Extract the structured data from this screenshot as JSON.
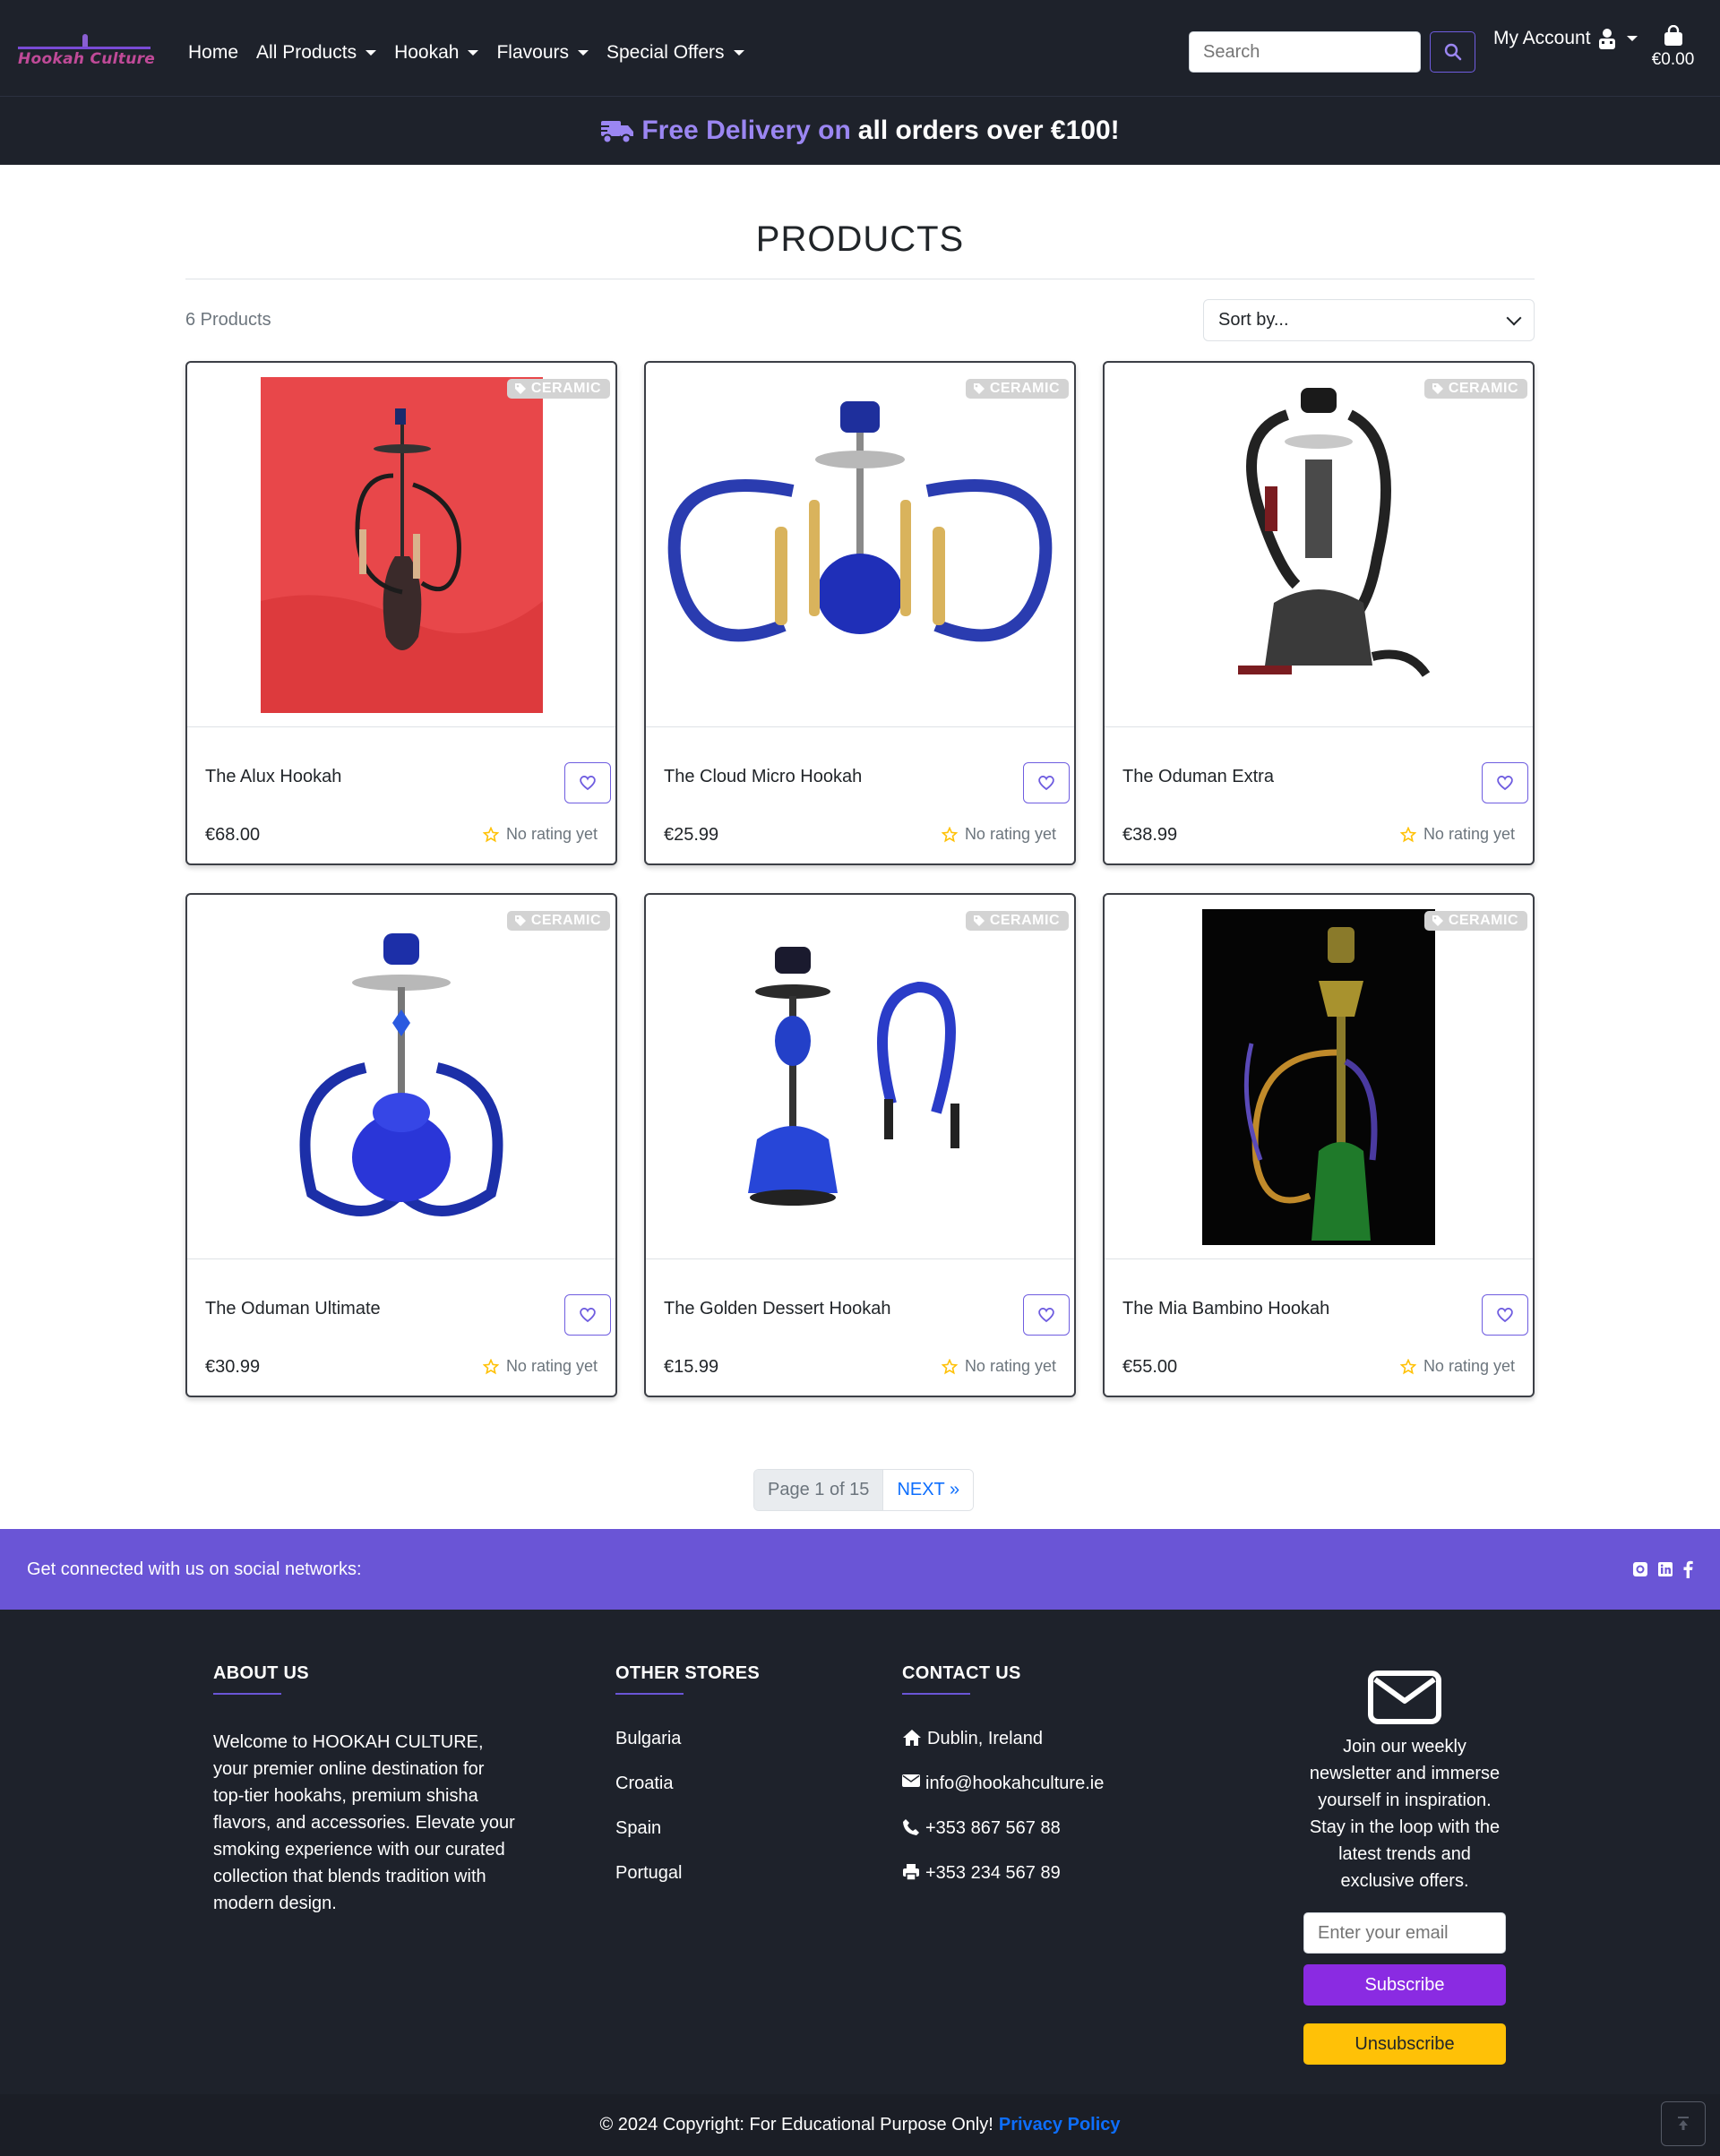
{
  "colors": {
    "accent": "#6a55d6",
    "dark_bg": "#1e222b",
    "promo_purple": "#9b86f2",
    "subscribe": "#8a2be2",
    "unsubscribe": "#ffc107",
    "link_blue": "#0d6efd"
  },
  "nav": {
    "logo_text": "Hookah Culture",
    "links": [
      {
        "label": "Home",
        "dropdown": false
      },
      {
        "label": "All Products",
        "dropdown": true
      },
      {
        "label": "Hookah",
        "dropdown": true
      },
      {
        "label": "Flavours",
        "dropdown": true
      },
      {
        "label": "Special Offers",
        "dropdown": true
      }
    ],
    "search_placeholder": "Search",
    "account_label": "My Account",
    "cart_total": "€0.00"
  },
  "promo": {
    "highlight": "Free Delivery on",
    "rest": "all orders over €100!"
  },
  "main": {
    "title": "PRODUCTS",
    "count": "6 Products",
    "sort_value": "Sort by..."
  },
  "products": [
    {
      "name": "The Alux Hookah",
      "price": "€68.00",
      "badge": "CERAMIC",
      "rating": "No rating yet",
      "image": "red-backdrop-hookah"
    },
    {
      "name": "The Cloud Micro Hookah",
      "price": "€25.99",
      "badge": "CERAMIC",
      "rating": "No rating yet",
      "image": "blue-double-hose-hookah"
    },
    {
      "name": "The Oduman Extra",
      "price": "€38.99",
      "badge": "CERAMIC",
      "rating": "No rating yet",
      "image": "black-checkered-hookah"
    },
    {
      "name": "The Oduman Ultimate",
      "price": "€30.99",
      "badge": "CERAMIC",
      "rating": "No rating yet",
      "image": "blue-frosted-hookah"
    },
    {
      "name": "The Golden Dessert Hookah",
      "price": "€15.99",
      "badge": "CERAMIC",
      "rating": "No rating yet",
      "image": "blue-hookah-with-hose"
    },
    {
      "name": "The Mia Bambino Hookah",
      "price": "€55.00",
      "badge": "CERAMIC",
      "rating": "No rating yet",
      "image": "gold-green-hookah-black-bg"
    }
  ],
  "pagination": {
    "info": "Page 1 of 15",
    "next": "NEXT »"
  },
  "social": {
    "text": "Get connected with us on social networks:",
    "icons": [
      "github-icon",
      "linkedin-icon",
      "facebook-icon"
    ]
  },
  "footer": {
    "about": {
      "heading": "ABOUT US",
      "text": "Welcome to HOOKAH CULTURE, your premier online destination for top-tier hookahs, premium shisha flavors, and accessories. Elevate your smoking experience with our curated collection that blends tradition with modern design."
    },
    "stores": {
      "heading": "OTHER STORES",
      "items": [
        "Bulgaria",
        "Croatia",
        "Spain",
        "Portugal"
      ]
    },
    "contact": {
      "heading": "CONTACT US",
      "address": "Dublin, Ireland",
      "email": "info@hookahculture.ie",
      "phone": "+353 867 567 88",
      "fax": "+353 234 567 89"
    },
    "newsletter": {
      "text": "Join our weekly newsletter and immerse yourself in inspiration. Stay in the loop with the latest trends and exclusive offers.",
      "email_placeholder": "Enter your email",
      "subscribe": "Subscribe",
      "unsubscribe": "Unsubscribe"
    }
  },
  "copyright": {
    "text": "© 2024 Copyright: For Educational Purpose Only!",
    "link": "Privacy Policy"
  }
}
